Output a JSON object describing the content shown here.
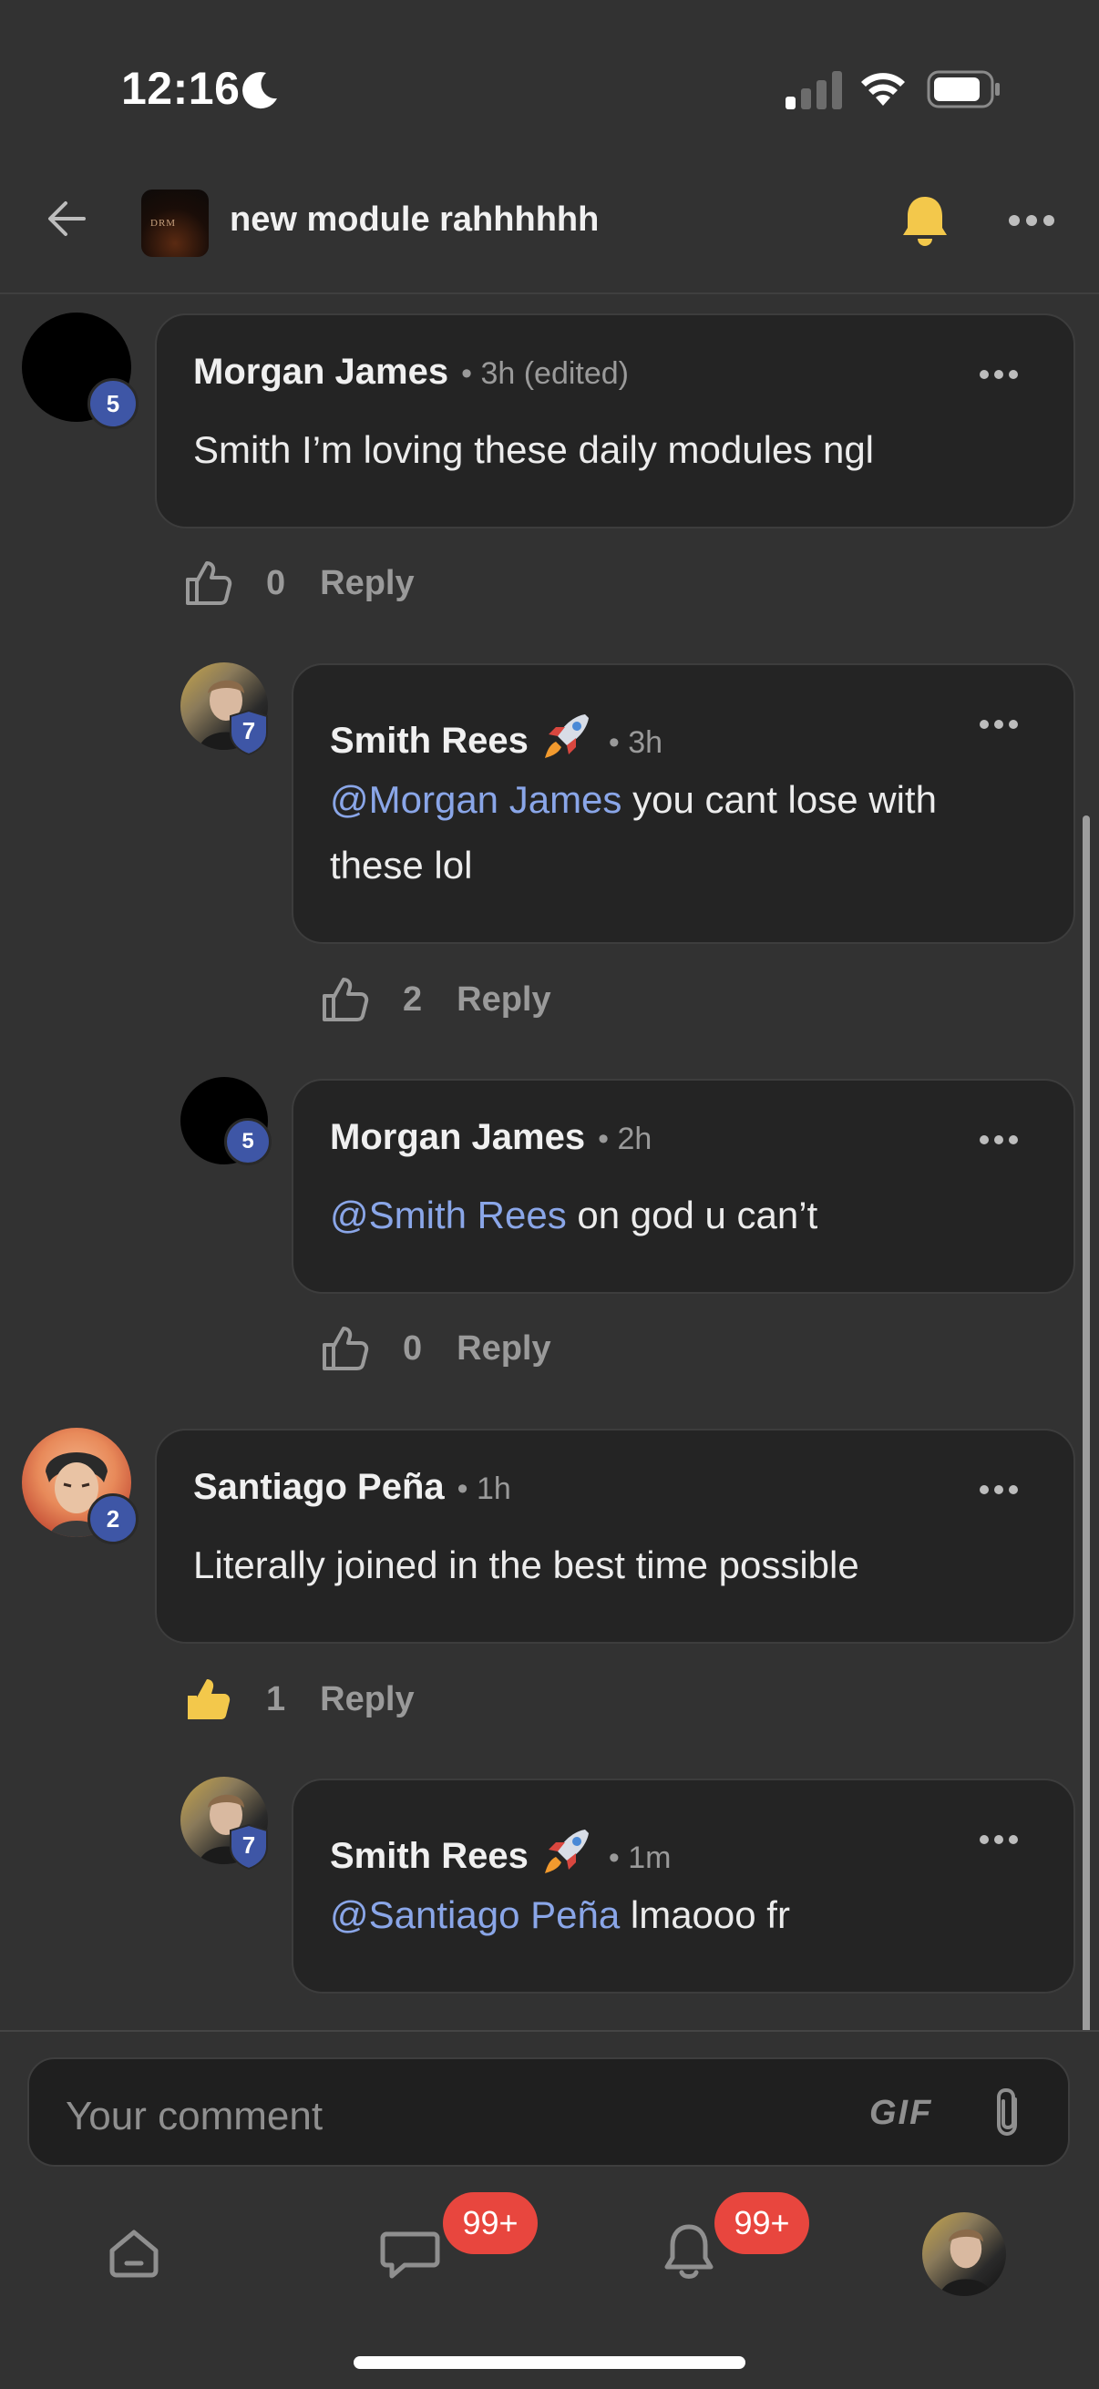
{
  "status_bar": {
    "time": "12:16"
  },
  "header": {
    "title": "new module rahhhhhh",
    "thumb_text": "DRM"
  },
  "comments": [
    {
      "author": "Morgan James",
      "meta": "• 3h (edited)",
      "badge": "5",
      "text": "Smith I’m loving these daily modules ngl",
      "likes": "0",
      "reply": "Reply"
    },
    {
      "author": "Smith Rees",
      "meta": "• 3h",
      "badge": "7",
      "mention": "@Morgan James",
      "text_line1": " you cant lose with",
      "text_line2": "these lol",
      "likes": "2",
      "reply": "Reply"
    },
    {
      "author": "Morgan James",
      "meta": "• 2h",
      "badge": "5",
      "mention": "@Smith Rees",
      "text": " on god u can’t",
      "likes": "0",
      "reply": "Reply"
    },
    {
      "author": "Santiago Peña",
      "meta": "• 1h",
      "badge": "2",
      "text": "Literally joined in the best time possible",
      "likes": "1",
      "reply": "Reply"
    },
    {
      "author": "Smith Rees",
      "meta": "• 1m",
      "badge": "7",
      "mention": "@Santiago Peña",
      "text": " lmaooo fr"
    }
  ],
  "composer": {
    "placeholder": "Your comment",
    "gif": "GIF"
  },
  "tabbar": {
    "chat_badge": "99+",
    "notif_badge": "99+"
  },
  "colors": {
    "mention": "#8aa6e8",
    "badge_blue": "#3e56a6",
    "bell": "#f3c84b",
    "alert_red": "#e8463e"
  },
  "icons": [
    "back-arrow-icon",
    "bell-icon",
    "more-icon",
    "thumbs-up-icon",
    "rocket-emoji",
    "paperclip-icon",
    "home-icon",
    "chat-icon",
    "notification-bell-icon"
  ]
}
